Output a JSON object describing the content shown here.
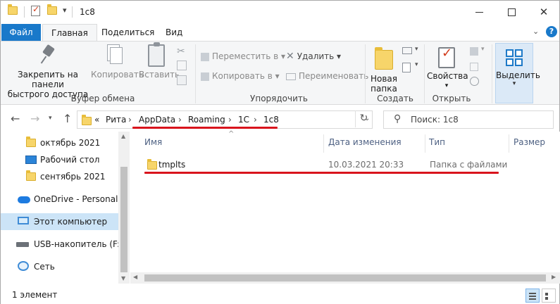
{
  "window": {
    "title": "1c8"
  },
  "ribbon_tabs": {
    "file": "Файл",
    "home": "Главная",
    "share": "Поделиться",
    "view": "Вид"
  },
  "clipboard": {
    "pin": [
      "Закрепить на панели",
      "быстрого доступа"
    ],
    "copy": "Копировать",
    "paste": "Вставить",
    "group_label": "Буфер обмена"
  },
  "organize": {
    "move_to": "Переместить в",
    "copy_to": "Копировать в",
    "delete": "Удалить",
    "rename": "Переименовать",
    "group_label": "Упорядочить"
  },
  "create": {
    "new_folder": [
      "Новая",
      "папка"
    ],
    "group_label": "Создать"
  },
  "open": {
    "properties": "Свойства",
    "group_label": "Открыть"
  },
  "select": {
    "label": "Выделить"
  },
  "address": {
    "overflow": "«",
    "crumbs": [
      "Рита",
      "AppData",
      "Roaming",
      "1C",
      "1c8"
    ],
    "separator": "›"
  },
  "search": {
    "placeholder": "Поиск: 1c8"
  },
  "nav_pane": {
    "items": [
      {
        "label": "октябрь 2021",
        "icon": "folder-icon"
      },
      {
        "label": "Рабочий стол",
        "icon": "desktop-icon"
      },
      {
        "label": "сентябрь 2021",
        "icon": "folder-icon"
      },
      {
        "label": "OneDrive - Personal",
        "icon": "onedrive-icon"
      },
      {
        "label": "Этот компьютер",
        "icon": "computer-icon",
        "selected": true
      },
      {
        "label": "USB-накопитель (F:)",
        "icon": "usb-drive-icon"
      },
      {
        "label": "Сеть",
        "icon": "network-icon"
      }
    ]
  },
  "columns": {
    "name": "Имя",
    "date": "Дата изменения",
    "type": "Тип",
    "size": "Размер"
  },
  "files": [
    {
      "name": "tmplts",
      "date": "10.03.2021 20:33",
      "type": "Папка с файлами"
    }
  ],
  "status": {
    "count": "1 элемент"
  },
  "colors": {
    "accent": "#1979ca",
    "highlight_underline": "#d9141d",
    "selection": "#cce4f7"
  }
}
